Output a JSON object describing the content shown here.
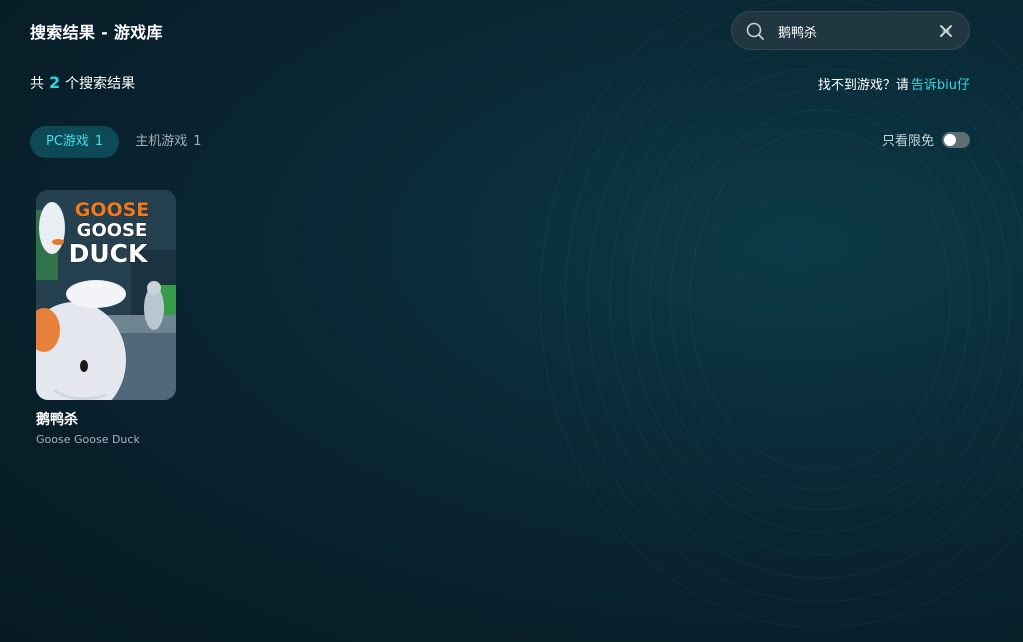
{
  "header": {
    "title": "搜索结果 - 游戏库"
  },
  "search": {
    "value": "鹅鸭杀",
    "placeholder": ""
  },
  "results": {
    "prefix": "共",
    "count": "2",
    "suffix": "个搜索结果"
  },
  "help": {
    "text": "找不到游戏？请",
    "link_label": "告诉biu仔"
  },
  "tabs": [
    {
      "label": "PC游戏",
      "count": "1",
      "active": true
    },
    {
      "label": "主机游戏",
      "count": "1",
      "active": false
    }
  ],
  "filter": {
    "free_only_label": "只看限免",
    "free_only_enabled": false
  },
  "games": [
    {
      "name": "鹅鸭杀",
      "subtitle": "Goose Goose Duck",
      "cover_logo": [
        "GOOSE",
        "GOOSE",
        "DUCK"
      ]
    }
  ],
  "colors": {
    "accent": "#2fd7e2",
    "active_tab_bg": "#0d4a55",
    "logo_orange": "#f07a22"
  }
}
